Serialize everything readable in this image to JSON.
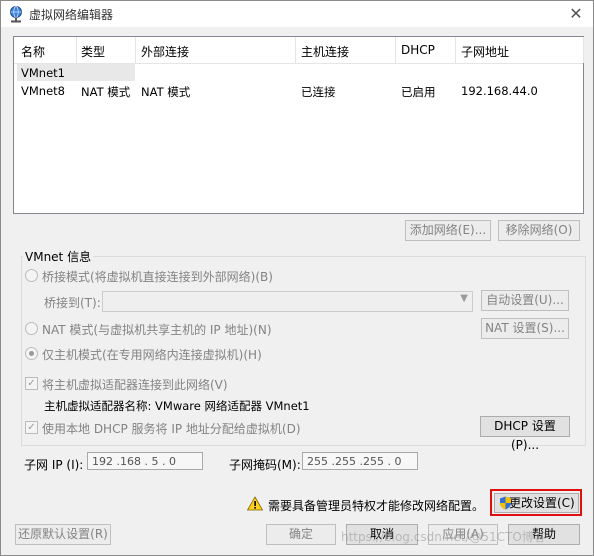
{
  "window": {
    "title": "虚拟网络编辑器",
    "close_symbol": "✕"
  },
  "table": {
    "columns": [
      "名称",
      "类型",
      "外部连接",
      "主机连接",
      "DHCP",
      "子网地址"
    ],
    "rows": [
      {
        "name": "VMnet1",
        "type": "",
        "external": "",
        "host": "",
        "dhcp": "",
        "subnet": ""
      },
      {
        "name": "VMnet8",
        "type": "NAT 模式",
        "external": "NAT 模式",
        "host": "已连接",
        "dhcp": "已启用",
        "subnet": "192.168.44.0"
      }
    ]
  },
  "buttons": {
    "add_network": "添加网络(E)...",
    "remove_network": "移除网络(O)",
    "auto_settings": "自动设置(U)...",
    "nat_settings": "NAT 设置(S)...",
    "dhcp_settings": "DHCP 设置(P)...",
    "change_settings": "更改设置(C)",
    "restore_defaults": "还原默认设置(R)",
    "ok": "确定",
    "cancel": "取消",
    "apply": "应用(A)",
    "help": "帮助"
  },
  "vmnet_info": {
    "group_label": "VMnet 信息",
    "bridged_mode": "桥接模式(将虚拟机直接连接到外部网络)(B)",
    "bridged_to": "桥接到(T):",
    "nat_mode": "NAT 模式(与虚拟机共享主机的 IP 地址)(N)",
    "host_only": "仅主机模式(在专用网络内连接虚拟机)(H)",
    "connect_host_adapter": "将主机虚拟适配器连接到此网络(V)",
    "adapter_name": "主机虚拟适配器名称: VMware 网络适配器 VMnet1",
    "use_dhcp": "使用本地 DHCP 服务将 IP 地址分配给虚拟机(D)",
    "selected_mode": "host_only"
  },
  "subnet": {
    "ip_label": "子网 IP (I):",
    "ip_value": "192 .168 . 5  . 0",
    "mask_label": "子网掩码(M):",
    "mask_value": "255 .255 .255 . 0"
  },
  "notice": "需要具备管理员特权才能修改网络配置。",
  "watermark": "https://blog.csdn.net/@51CTO博客",
  "icons": [
    "network-app-icon",
    "close-icon",
    "warning-icon",
    "shield-icon",
    "dropdown-arrow-icon"
  ]
}
